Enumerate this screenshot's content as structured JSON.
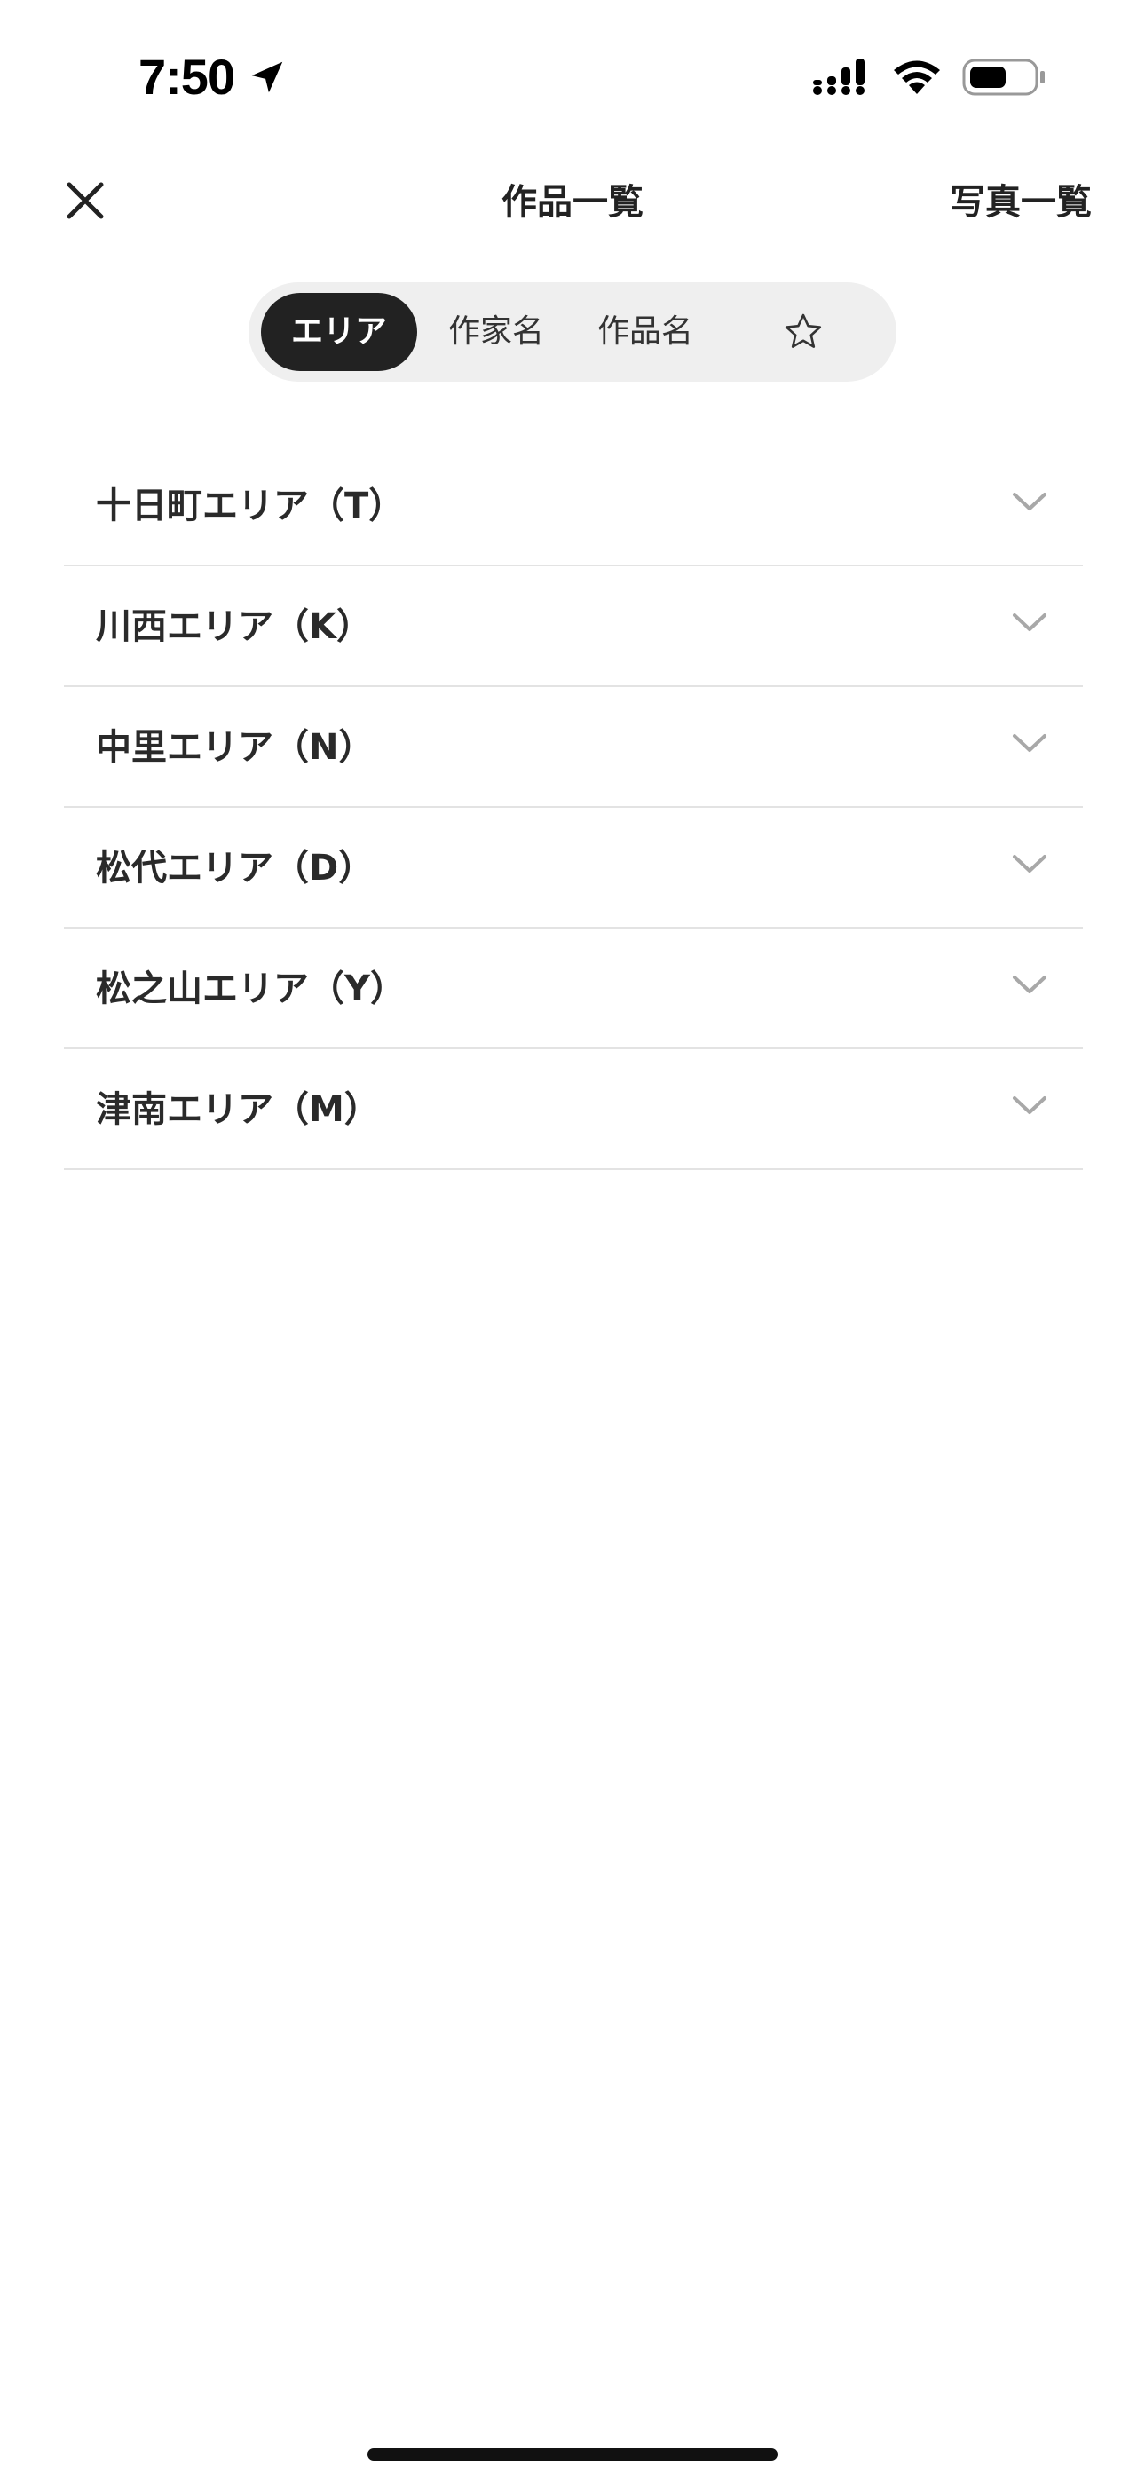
{
  "status_bar": {
    "time": "7:50"
  },
  "header": {
    "title": "作品一覧",
    "photo_link_label": "写真一覧"
  },
  "tabs": [
    {
      "label": "エリア",
      "active": true
    },
    {
      "label": "作家名",
      "active": false
    },
    {
      "label": "作品名",
      "active": false
    },
    {
      "label": "",
      "icon": "star-icon",
      "active": false
    }
  ],
  "areas": [
    {
      "label": "十日町エリア（T）"
    },
    {
      "label": "川西エリア（K）"
    },
    {
      "label": "中里エリア（N）"
    },
    {
      "label": "松代エリア（D）"
    },
    {
      "label": "松之山エリア（Y）"
    },
    {
      "label": "津南エリア（M）"
    }
  ],
  "colors": {
    "active_tab_bg": "#222222",
    "segment_bg": "#efefef",
    "divider": "#e3e3e3",
    "chevron": "#a8a8a8"
  }
}
